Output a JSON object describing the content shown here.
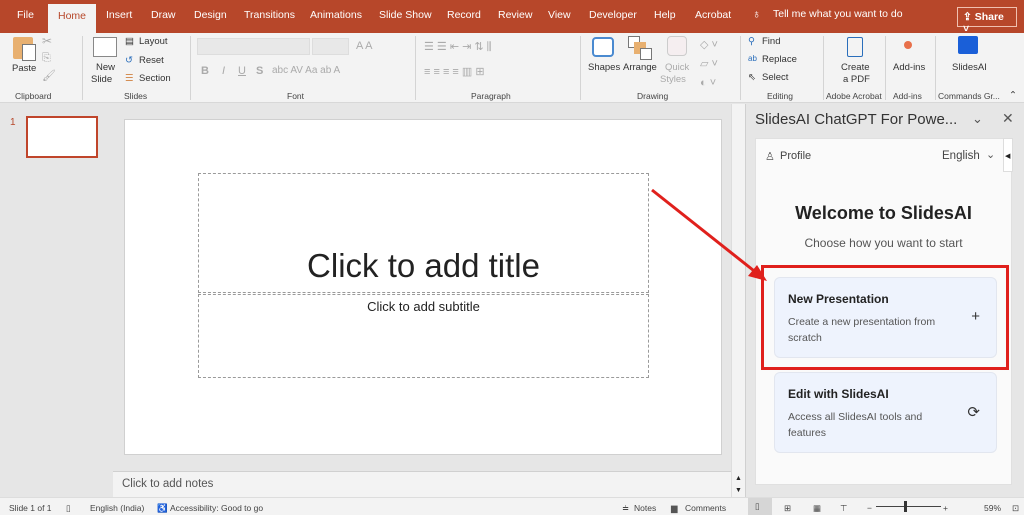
{
  "tabs": [
    "File",
    "Home",
    "Insert",
    "Draw",
    "Design",
    "Transitions",
    "Animations",
    "Slide Show",
    "Record",
    "Review",
    "View",
    "Developer",
    "Help",
    "Acrobat"
  ],
  "active_tab": "Home",
  "tell_me": "Tell me what you want to do",
  "share": "Share",
  "ribbon": {
    "clipboard": {
      "paste": "Paste",
      "label": "Clipboard"
    },
    "slides": {
      "new_slide_1": "New",
      "new_slide_2": "Slide",
      "layout": "Layout",
      "reset": "Reset",
      "section": "Section",
      "label": "Slides"
    },
    "font": {
      "bold": "B",
      "italic": "I",
      "underline": "U",
      "strike": "S",
      "label": "Font"
    },
    "paragraph": {
      "label": "Paragraph"
    },
    "drawing": {
      "shapes": "Shapes",
      "arrange": "Arrange",
      "quick1": "Quick",
      "quick2": "Styles",
      "label": "Drawing"
    },
    "editing": {
      "find": "Find",
      "replace": "Replace",
      "select": "Select",
      "label": "Editing"
    },
    "acrobat": {
      "create1": "Create",
      "create2": "a PDF",
      "label": "Adobe Acrobat"
    },
    "addins": {
      "addins": "Add-ins",
      "label": "Add-ins"
    },
    "commands": {
      "slidesai": "SlidesAI",
      "label": "Commands Gr..."
    }
  },
  "thumbnail": {
    "number": "1"
  },
  "slide": {
    "title_placeholder": "Click to add title",
    "subtitle_placeholder": "Click to add subtitle"
  },
  "notes": "Click to add notes",
  "pane": {
    "title": "SlidesAI ChatGPT For Powe...",
    "profile": "Profile",
    "language": "English",
    "welcome": "Welcome to SlidesAI",
    "subtitle": "Choose how you want to start",
    "cards": [
      {
        "title": "New Presentation",
        "desc": "Create a new presentation from scratch",
        "icon": "plus-icon"
      },
      {
        "title": "Edit with SlidesAI",
        "desc": "Access all SlidesAI tools and features",
        "icon": "refresh-icon"
      }
    ]
  },
  "status": {
    "slide": "Slide 1 of 1",
    "language": "English (India)",
    "accessibility": "Accessibility: Good to go",
    "notes": "Notes",
    "comments": "Comments",
    "zoom": "59%"
  },
  "colors": {
    "brand": "#b7472a",
    "highlight": "#e0201c",
    "card": "#eef3fd"
  }
}
